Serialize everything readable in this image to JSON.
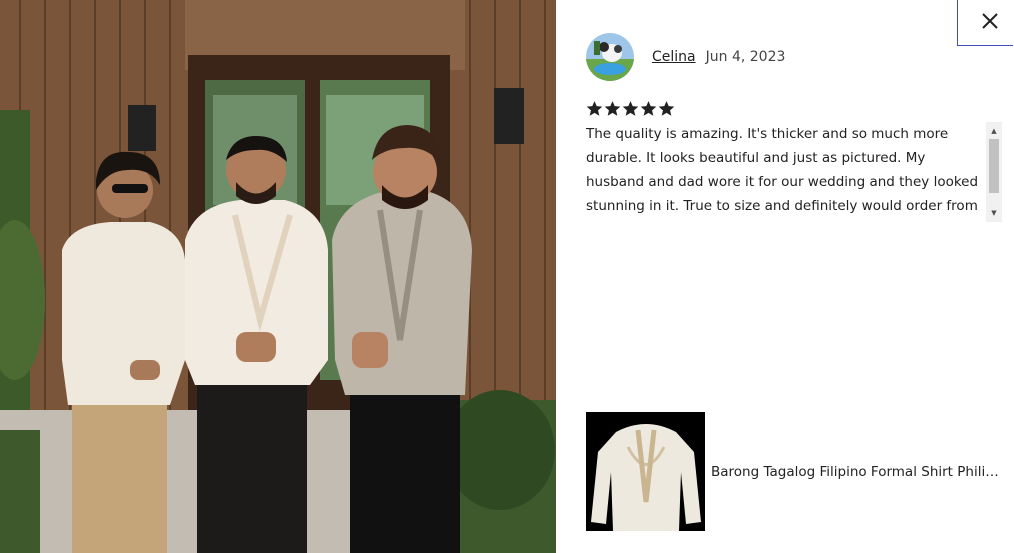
{
  "close_button": {
    "icon": "close-icon"
  },
  "reviewer": {
    "name": "Celina",
    "date": "Jun 4, 2023",
    "avatar_icon": "avatar"
  },
  "review": {
    "rating": 5,
    "rating_max": 5,
    "text": "The quality is amazing. It's thicker and so much more durable. It looks beautiful and just as pictured. My husband and dad wore it for our wedding and they looked stunning in it. True to size and definitely would order from this shop"
  },
  "scrollbar": {
    "up_arrow": "▲",
    "down_arrow": "▼"
  },
  "product": {
    "title": "Barong Tagalog Filipino Formal Shirt Philippine Barong Tagalog"
  },
  "colors": {
    "close_border": "#3f51b5",
    "text": "#222222",
    "star": "#222222"
  }
}
